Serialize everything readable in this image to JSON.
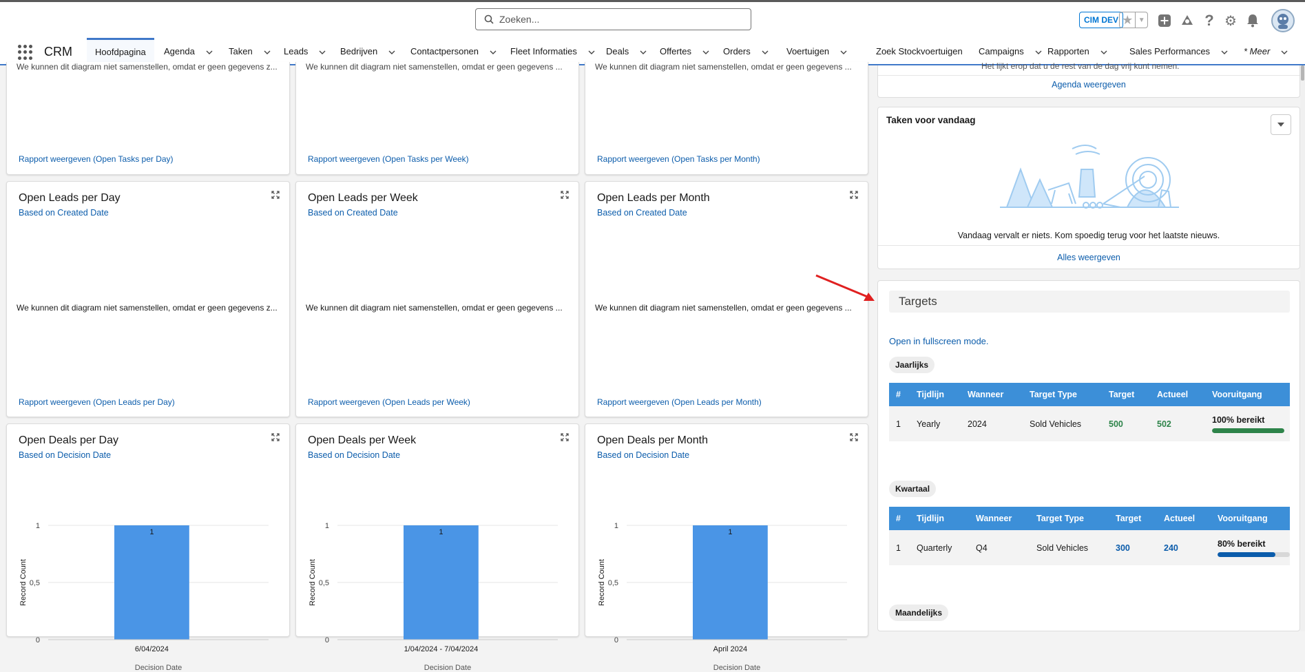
{
  "header": {
    "search_placeholder": "Zoeken...",
    "org_badge": "CIM DEV",
    "icons": [
      "star-icon",
      "chevron-down-icon",
      "add-icon",
      "trailhead-icon",
      "help-icon",
      "gear-icon",
      "bell-icon",
      "avatar"
    ]
  },
  "nav": {
    "app_name": "CRM",
    "tabs": [
      {
        "label": "Hoofdpagina",
        "active": true,
        "chevron": false
      },
      {
        "label": "Agenda",
        "chevron": true
      },
      {
        "label": "Taken",
        "chevron": true
      },
      {
        "label": "Leads",
        "chevron": true
      },
      {
        "label": "Bedrijven",
        "chevron": true
      },
      {
        "label": "Contactpersonen",
        "chevron": true
      },
      {
        "label": "Fleet Informaties",
        "chevron": true
      },
      {
        "label": "Deals",
        "chevron": true
      },
      {
        "label": "Offertes",
        "chevron": true
      },
      {
        "label": "Orders",
        "chevron": true
      },
      {
        "label": "Voertuigen",
        "chevron": true
      },
      {
        "label": "Zoek Stockvoertuigen",
        "chevron": false
      },
      {
        "label": "Campaigns",
        "chevron": true
      },
      {
        "label": "Rapporten",
        "chevron": true
      },
      {
        "label": "Sales Performances",
        "chevron": true
      },
      {
        "label": "* Meer",
        "chevron": true
      }
    ]
  },
  "tasks_row": [
    {
      "msg": "We kunnen dit diagram niet samenstellen, omdat er geen gegevens z...",
      "link": "Rapport weergeven (Open Tasks per Day)"
    },
    {
      "msg": "We kunnen dit diagram niet samenstellen, omdat er geen gegevens ...",
      "link": "Rapport weergeven (Open Tasks per Week)"
    },
    {
      "msg": "We kunnen dit diagram niet samenstellen, omdat er geen gegevens ...",
      "link": "Rapport weergeven (Open Tasks per Month)"
    }
  ],
  "leads_row": [
    {
      "title": "Open Leads per Day",
      "subtitle": "Based on Created Date",
      "msg": "We kunnen dit diagram niet samenstellen, omdat er geen gegevens z...",
      "link": "Rapport weergeven (Open Leads per Day)"
    },
    {
      "title": "Open Leads per Week",
      "subtitle": "Based on Created Date",
      "msg": "We kunnen dit diagram niet samenstellen, omdat er geen gegevens ...",
      "link": "Rapport weergeven (Open Leads per Week)"
    },
    {
      "title": "Open Leads per Month",
      "subtitle": "Based on Created Date",
      "msg": "We kunnen dit diagram niet samenstellen, omdat er geen gegevens ...",
      "link": "Rapport weergeven (Open Leads per Month)"
    }
  ],
  "deals_row": [
    {
      "title": "Open Deals per Day",
      "subtitle": "Based on Decision Date"
    },
    {
      "title": "Open Deals per Week",
      "subtitle": "Based on Decision Date"
    },
    {
      "title": "Open Deals per Month",
      "subtitle": "Based on Decision Date"
    }
  ],
  "chart_data": [
    {
      "type": "bar",
      "categories": [
        "6/04/2024"
      ],
      "values": [
        1
      ],
      "data_labels": [
        "1"
      ],
      "xlabel": "Decision Date",
      "ylabel": "Record Count",
      "yticks": [
        "0",
        "0,5",
        "1"
      ],
      "ylim": [
        0,
        1
      ],
      "color": "#4a95e6"
    },
    {
      "type": "bar",
      "categories": [
        "1/04/2024 - 7/04/2024"
      ],
      "values": [
        1
      ],
      "data_labels": [
        "1"
      ],
      "xlabel": "Decision Date",
      "ylabel": "Record Count",
      "yticks": [
        "0",
        "0,5",
        "1"
      ],
      "ylim": [
        0,
        1
      ],
      "color": "#4a95e6"
    },
    {
      "type": "bar",
      "categories": [
        "April 2024"
      ],
      "values": [
        1
      ],
      "data_labels": [
        "1"
      ],
      "xlabel": "Decision Date",
      "ylabel": "Record Count",
      "yticks": [
        "0",
        "0,5",
        "1"
      ],
      "ylim": [
        0,
        1
      ],
      "color": "#4a95e6"
    }
  ],
  "agenda": {
    "cut_text": "Het lijkt erop dat u de rest van de dag vrij kunt nemen.",
    "link": "Agenda weergeven"
  },
  "taken": {
    "title": "Taken voor vandaag",
    "msg": "Vandaag vervalt er niets. Kom spoedig terug voor het laatste nieuws.",
    "link": "Alles weergeven"
  },
  "targets": {
    "title": "Targets",
    "fullscreen_link": "Open in fullscreen mode.",
    "columns": [
      "#",
      "Tijdlijn",
      "Wanneer",
      "Target Type",
      "Target",
      "Actueel",
      "Vooruitgang"
    ],
    "sections": [
      {
        "label": "Jaarlijks",
        "rows": [
          {
            "num": "1",
            "timeline": "Yearly",
            "when": "2024",
            "type": "Sold Vehicles",
            "target": "500",
            "actual": "502",
            "progress_label": "100% bereikt",
            "progress": 1.0,
            "color": "#2e844a"
          }
        ]
      },
      {
        "label": "Kwartaal",
        "rows": [
          {
            "num": "1",
            "timeline": "Quarterly",
            "when": "Q4",
            "type": "Sold Vehicles",
            "target": "300",
            "actual": "240",
            "progress_label": "80% bereikt",
            "progress": 0.8,
            "color": "#0b5cab"
          }
        ]
      },
      {
        "label": "Maandelijks",
        "rows": []
      }
    ]
  },
  "colors": {
    "accent": "#3f78c9",
    "link": "#0b5cab",
    "bar": "#4a95e6",
    "table_header": "#3c8fd8",
    "arrow": "#e02020"
  }
}
